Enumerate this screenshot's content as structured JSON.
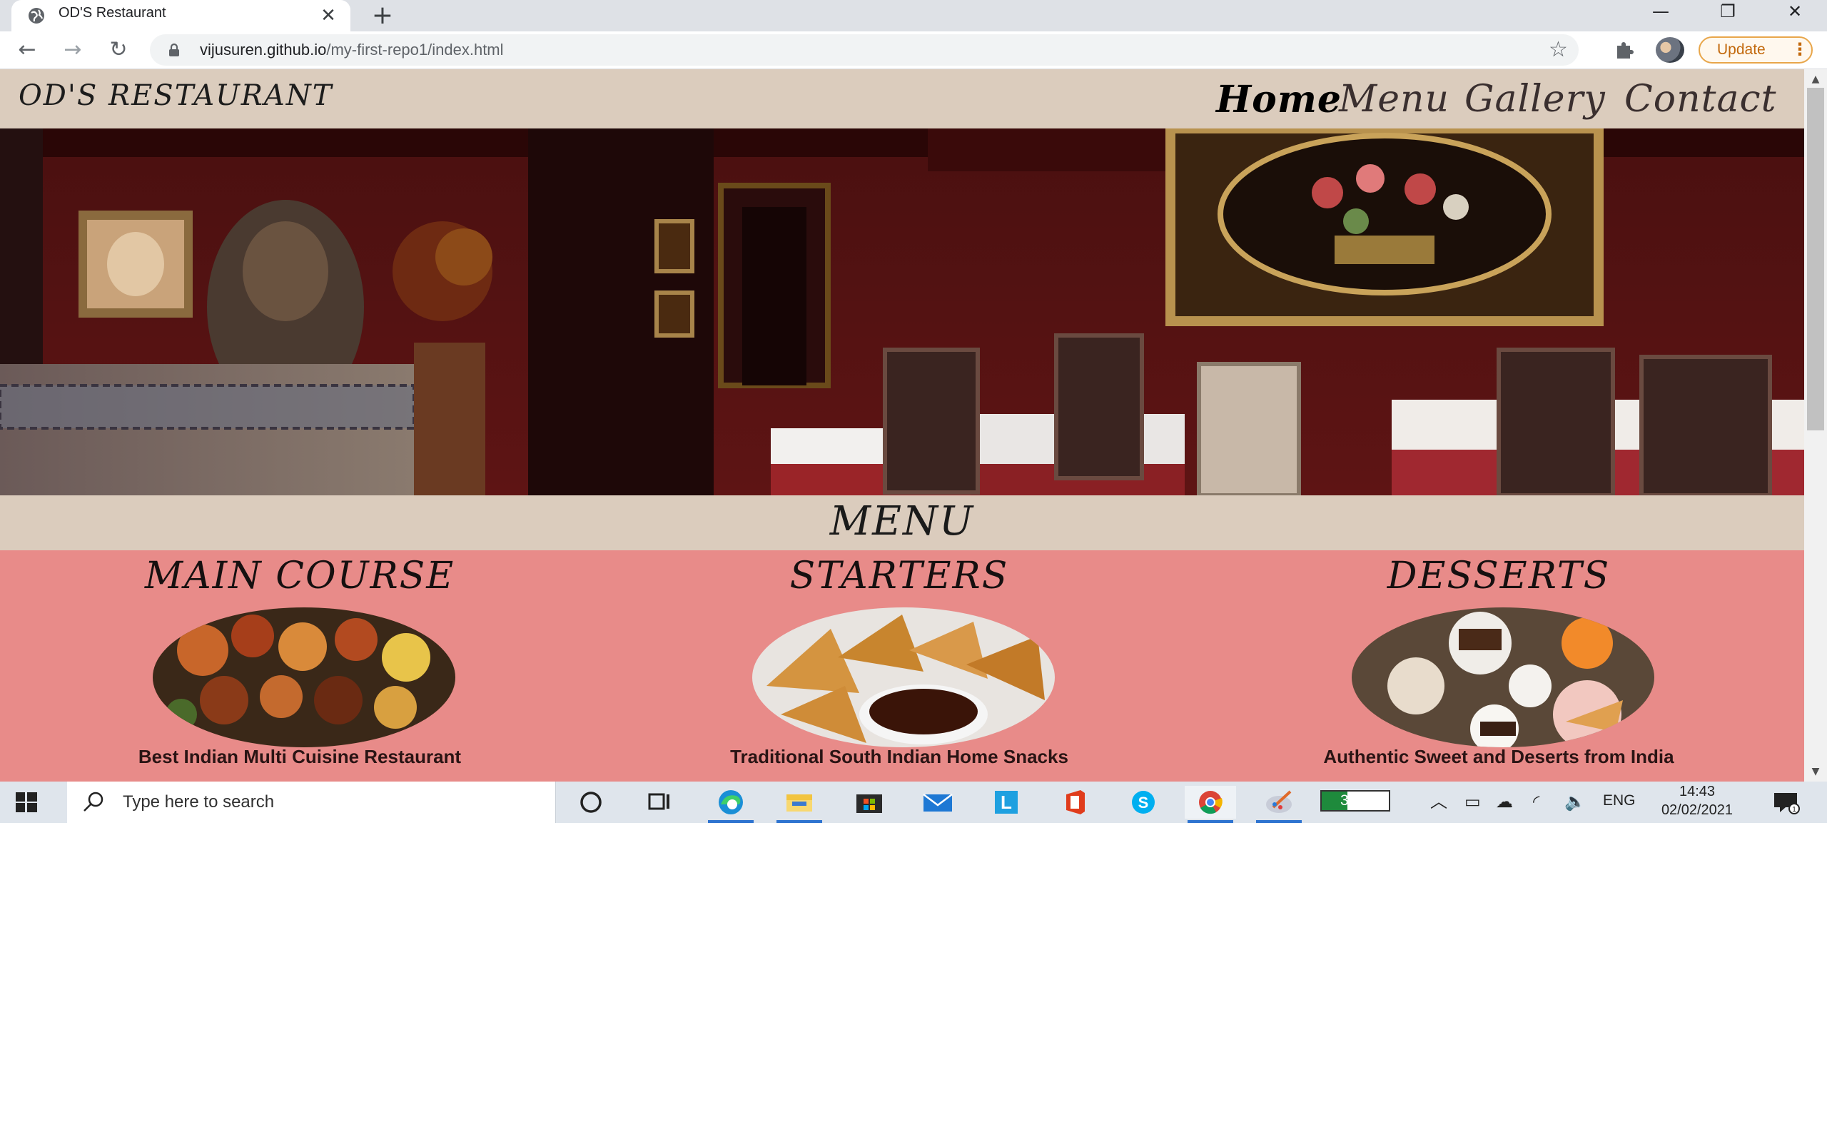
{
  "browser": {
    "tab": {
      "title": "OD'S Restaurant",
      "close_glyph": "✕",
      "favicon": "globe-icon"
    },
    "new_tab_glyph": "+",
    "window_controls": {
      "minimize": "—",
      "maximize": "❐",
      "close": "✕"
    },
    "nav": {
      "back": "←",
      "forward": "→",
      "reload": "↻"
    },
    "url": {
      "host": "vijusuren.github.io",
      "path": "/my-first-repo1/index.html"
    },
    "bookmark_glyph": "☆",
    "update_button": {
      "label": "Update",
      "menu": "⋮"
    },
    "accent_color": "#e8a64a"
  },
  "site": {
    "logo": "OD'S RESTAURANT",
    "nav": [
      {
        "label": "Home",
        "active": true
      },
      {
        "label": "Menu",
        "active": false
      },
      {
        "label": "Gallery",
        "active": false
      },
      {
        "label": "Contact",
        "active": false
      }
    ],
    "menu_heading": "MENU",
    "menu_items": [
      {
        "title": "MAIN COURSE",
        "caption": "Best Indian Multi Cuisine Restaurant",
        "image": "indian-dishes-photo"
      },
      {
        "title": "STARTERS",
        "caption": "Traditional South Indian Home Snacks",
        "image": "samosa-photo"
      },
      {
        "title": "DESSERTS",
        "caption": "Authentic Sweet and Deserts from India",
        "image": "desserts-photo"
      }
    ],
    "colors": {
      "header_bg": "#dbccbd",
      "menu_bg": "#e88b89"
    }
  },
  "taskbar": {
    "search_placeholder": "Type here to search",
    "battery_percent": "38%",
    "battery_level": 0.38,
    "language": "ENG",
    "time": "14:43",
    "date": "02/02/2021",
    "pinned": [
      "cortana-icon",
      "task-view-icon",
      "edge-icon",
      "file-explorer-icon",
      "store-icon",
      "mail-icon",
      "l-app-icon",
      "office-icon",
      "skype-icon",
      "chrome-icon",
      "paint-icon"
    ]
  }
}
